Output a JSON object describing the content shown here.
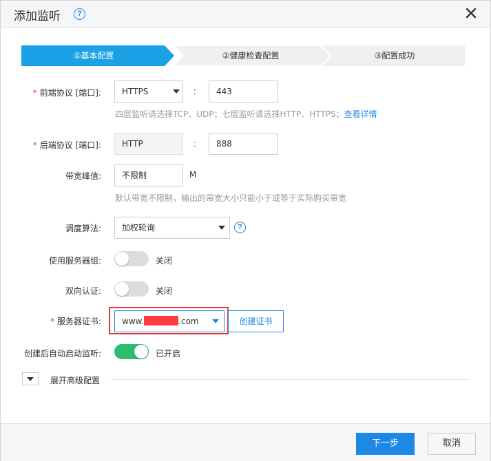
{
  "dialog": {
    "title": "添加监听"
  },
  "steps": [
    {
      "label": "①基本配置",
      "active": true
    },
    {
      "label": "②健康检查配置",
      "active": false
    },
    {
      "label": "③配置成功",
      "active": false
    }
  ],
  "form": {
    "frontend": {
      "label": "前端协议 [端口]:",
      "protocol": "HTTPS",
      "port": "443",
      "hint": "四层监听请选择TCP、UDP；七层监听请选择HTTP、HTTPS；",
      "hint_link": "查看详情"
    },
    "backend": {
      "label": "后端协议 [端口]:",
      "protocol": "HTTP",
      "port": "888"
    },
    "bandwidth": {
      "label": "带宽峰值:",
      "value": "不限制",
      "unit": "M",
      "hint": "默认带宽不限制，输出的带宽大小只能小于或等于实际购买带宽"
    },
    "algorithm": {
      "label": "调度算法:",
      "value": "加权轮询"
    },
    "server_group": {
      "label": "使用服务器组:",
      "state": "关闭",
      "on": false
    },
    "mutual_auth": {
      "label": "双向认证:",
      "state": "关闭",
      "on": false
    },
    "certificate": {
      "label": "服务器证书:",
      "value_prefix": "www.",
      "value_suffix": ".com",
      "create_button": "创建证书"
    },
    "auto_start": {
      "label": "创建后自动启动监听:",
      "state": "已开启",
      "on": true
    },
    "advanced": {
      "label": "展开高级配置"
    }
  },
  "footer": {
    "next_button": "下一步",
    "cancel_button": "取消"
  },
  "colors": {
    "accent": "#1e88e5",
    "step_active": "#1aa1e6",
    "step_inactive": "#eef0f2",
    "toggle_on": "#2dbd6e",
    "toggle_off": "#dcdcdc",
    "required": "#e53935",
    "highlight_box": "#e53935",
    "redaction": "#ff3b3b"
  }
}
